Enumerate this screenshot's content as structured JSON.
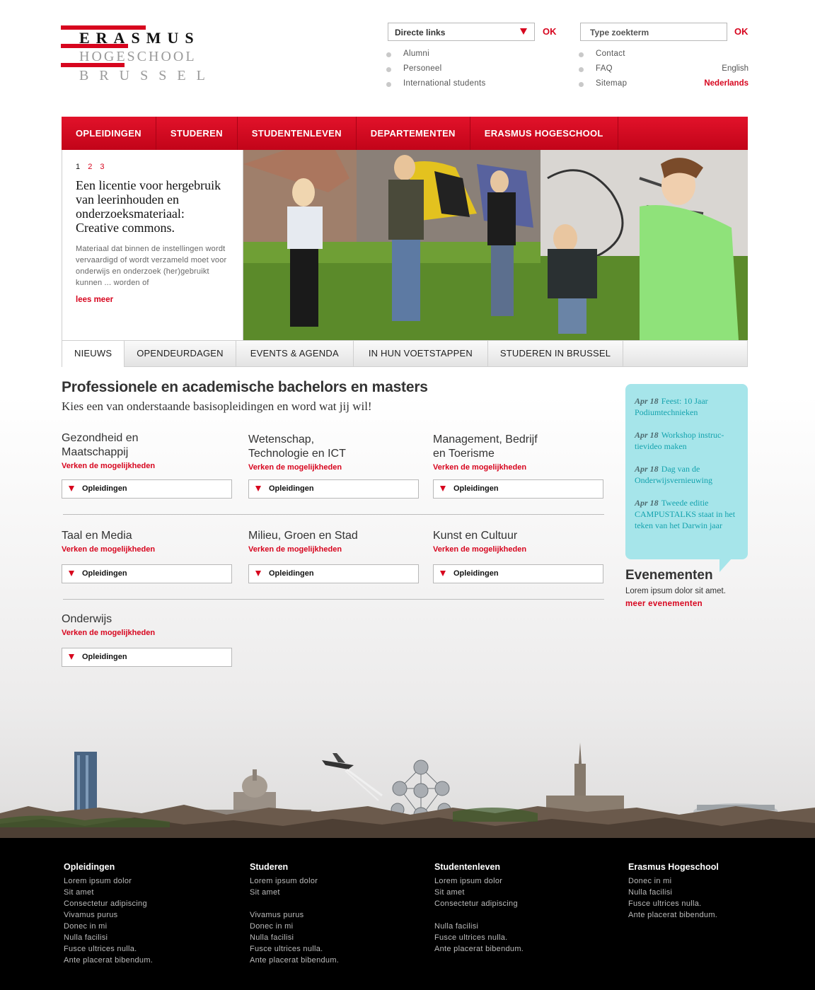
{
  "logo": {
    "line1": "ERASMUS",
    "line2": "HOGESCHOOL",
    "line3": "BRUSSEL"
  },
  "header": {
    "direct_links_label": "Directe links",
    "ok1": "OK",
    "search_placeholder": "Type zoekterm",
    "ok2": "OK",
    "links_left": [
      "Alumni",
      "Personeel",
      "International students"
    ],
    "links_right": [
      "Contact",
      "FAQ",
      "Sitemap"
    ],
    "lang_english": "English",
    "lang_dutch": "Nederlands"
  },
  "nav": [
    "OPLEIDINGEN",
    "STUDEREN",
    "STUDENTENLEVEN",
    "DEPARTEMENTEN",
    "ERASMUS HOGESCHOOL"
  ],
  "hero": {
    "pages": [
      "1",
      "2",
      "3"
    ],
    "title": "Een licentie voor hergebruik van leerinhouden en onderzoeksmateriaal: Creative commons.",
    "body": "Materiaal dat binnen de instellingen wordt vervaardigd of wordt verzameld moet voor onderwijs en onderzoek (her)gebruikt kunnen ... worden of",
    "more": "lees meer"
  },
  "tabs": [
    "NIEUWS",
    "OPENDEURDAGEN",
    "EVENTS & AGENDA",
    "IN HUN VOETSTAPPEN",
    "STUDEREN IN BRUSSEL"
  ],
  "content": {
    "title": "Professionele en academische bachelors en masters",
    "subtitle": "Kies een van onderstaande basisopleidingen en word wat jij wil!",
    "link_label": "Verken de mogelijkheden",
    "dropdown_label": "Opleidingen",
    "categories": [
      "Gezondheid en Maatschappij",
      "Wetenschap, Technologie en ICT",
      "Management, Bedrijf en Toerisme",
      "Taal en Media",
      "Milieu, Groen en Stad",
      "Kunst en Cultuur",
      "Onderwijs"
    ]
  },
  "events": {
    "items": [
      {
        "date": "Apr 18",
        "title": "Feest: 10 Jaar Podiumtechnieken"
      },
      {
        "date": "Apr 18",
        "title": "Workshop instruc-tievideo maken"
      },
      {
        "date": "Apr 18",
        "title": "Dag van de Onderwijsvernieuwing"
      },
      {
        "date": "Apr 18",
        "title": "Tweede editie CAMPUSTALKS staat in het teken van het Darwin jaar"
      }
    ],
    "heading": "Evenementen",
    "text": "Lorem ipsum dolor sit amet.",
    "more": "meer evenementen"
  },
  "footer": {
    "col1": {
      "title": "Opleidingen",
      "items": [
        "Lorem ipsum dolor",
        "Sit amet",
        "Consectetur adipiscing",
        "Vivamus purus",
        "Donec in mi",
        "Nulla facilisi",
        "Fusce ultrices nulla.",
        "Ante placerat bibendum."
      ]
    },
    "col2": {
      "title": "Studeren",
      "items": [
        "Lorem ipsum dolor",
        "Sit amet",
        "",
        "Vivamus purus",
        "Donec in mi",
        "Nulla facilisi",
        "Fusce ultrices nulla.",
        "Ante placerat bibendum."
      ]
    },
    "col3": {
      "title": "Studentenleven",
      "items": [
        "Lorem ipsum dolor",
        "Sit amet",
        "Consectetur adipiscing",
        "",
        "Nulla facilisi",
        "Fusce ultrices nulla.",
        "Ante placerat bibendum."
      ]
    },
    "col4": {
      "title": "Erasmus Hogeschool",
      "items": [
        "Donec in mi",
        "Nulla facilisi",
        "Fusce ultrices nulla.",
        "Ante placerat bibendum."
      ]
    }
  },
  "colors": {
    "brand_red": "#d7051e",
    "events_bg": "#a6e5ea",
    "events_text": "#14a3ae"
  }
}
